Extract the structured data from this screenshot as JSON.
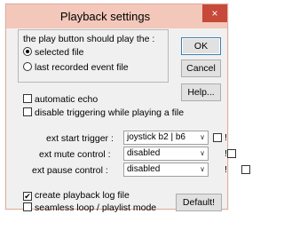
{
  "window": {
    "title": "Playback settings",
    "close_glyph": "×"
  },
  "play_group": {
    "label": "the play button should play the :",
    "options": [
      {
        "label": "selected file",
        "selected": true
      },
      {
        "label": "last recorded event file",
        "selected": false
      }
    ]
  },
  "buttons": {
    "ok": "OK",
    "cancel": "Cancel",
    "help": "Help...",
    "default": "Default!"
  },
  "checkboxes": {
    "automatic_echo": {
      "label": "automatic echo",
      "checked": false
    },
    "disable_triggering": {
      "label": "disable triggering while playing a file",
      "checked": false
    },
    "create_log": {
      "label": "create playback log file",
      "checked": true
    },
    "seamless_loop": {
      "label": "seamless loop / playlist mode",
      "checked": false
    }
  },
  "controls": [
    {
      "label": "ext start trigger :",
      "value": "joystick b2 | b6",
      "flag_checked": false,
      "flag_label": "!"
    },
    {
      "label": "ext mute control :",
      "value": "disabled",
      "flag_checked": false,
      "flag_label": "!"
    },
    {
      "label": "ext pause control :",
      "value": "disabled",
      "flag_checked": false,
      "flag_label": "!"
    }
  ],
  "glyphs": {
    "check_mark": "✔",
    "dropdown_arrow": "∨"
  }
}
